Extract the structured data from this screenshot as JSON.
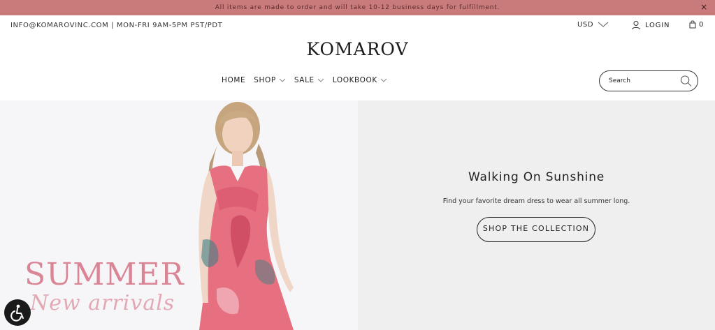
{
  "announcement": {
    "text": "All items are made to order and will take 10-12 business days for fulfillment.",
    "close_label": "×"
  },
  "topbar": {
    "contact": "INFO@KOMAROVINC.COM | MON-FRI 9AM-5PM PST/PDT",
    "currency": "USD",
    "login": "LOGIN",
    "cart_count": "0"
  },
  "logo": "KOMAROV",
  "nav": {
    "home": "HOME",
    "shop": "SHOP",
    "sale": "SALE",
    "lookbook": "LOOKBOOK"
  },
  "search": {
    "placeholder": "Search"
  },
  "hero": {
    "overlay_line1": "SUMMER",
    "overlay_line2": "New arrivals",
    "title": "Walking On Sunshine",
    "subtitle": "Find your favorite dream dress to wear all summer long.",
    "button": "SHOP THE COLLECTION"
  },
  "colors": {
    "announcement_bg": "#c97b7b",
    "accent_pink": "#d98596"
  },
  "icons": [
    "close-icon",
    "chevron-down-icon",
    "user-icon",
    "bag-icon",
    "search-icon",
    "accessibility-icon"
  ]
}
